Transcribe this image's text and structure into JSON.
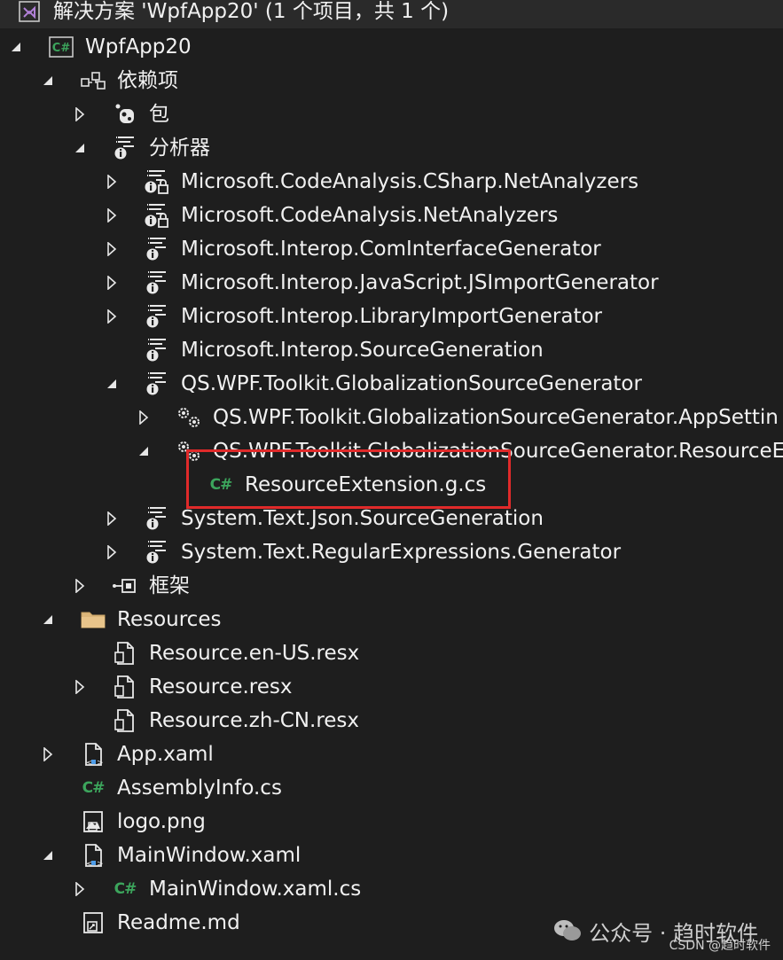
{
  "solution_title": "解决方案 'WpfApp20' (1 个项目，共 1 个)",
  "rows": [
    {
      "label": "WpfApp20",
      "icon": "csharp-project-icon",
      "indent": 0,
      "arrow": "expanded"
    },
    {
      "label": "依赖项",
      "icon": "dependencies-icon",
      "indent": 1,
      "arrow": "expanded"
    },
    {
      "label": "包",
      "icon": "package-icon",
      "indent": 2,
      "arrow": "collapsed"
    },
    {
      "label": "分析器",
      "icon": "analyzer-icon",
      "indent": 2,
      "arrow": "expanded"
    },
    {
      "label": "Microsoft.CodeAnalysis.CSharp.NetAnalyzers",
      "icon": "analyzer-lock-icon",
      "indent": 3,
      "arrow": "collapsed"
    },
    {
      "label": "Microsoft.CodeAnalysis.NetAnalyzers",
      "icon": "analyzer-lock-icon",
      "indent": 3,
      "arrow": "collapsed"
    },
    {
      "label": "Microsoft.Interop.ComInterfaceGenerator",
      "icon": "analyzer-icon",
      "indent": 3,
      "arrow": "collapsed"
    },
    {
      "label": "Microsoft.Interop.JavaScript.JSImportGenerator",
      "icon": "analyzer-icon",
      "indent": 3,
      "arrow": "collapsed"
    },
    {
      "label": "Microsoft.Interop.LibraryImportGenerator",
      "icon": "analyzer-icon",
      "indent": 3,
      "arrow": "collapsed"
    },
    {
      "label": "Microsoft.Interop.SourceGeneration",
      "icon": "analyzer-icon",
      "indent": 3,
      "arrow": "none"
    },
    {
      "label": "QS.WPF.Toolkit.GlobalizationSourceGenerator",
      "icon": "analyzer-icon",
      "indent": 3,
      "arrow": "expanded"
    },
    {
      "label": "QS.WPF.Toolkit.GlobalizationSourceGenerator.AppSettin",
      "icon": "generator-gears-icon",
      "indent": 4,
      "arrow": "collapsed"
    },
    {
      "label": "QS.WPF.Toolkit.GlobalizationSourceGenerator.ResourceE",
      "icon": "generator-gears-icon",
      "indent": 4,
      "arrow": "expanded"
    },
    {
      "label": "ResourceExtension.g.cs",
      "icon": "csharp-file-icon",
      "indent": 5,
      "arrow": "none"
    },
    {
      "label": "System.Text.Json.SourceGeneration",
      "icon": "analyzer-icon",
      "indent": 3,
      "arrow": "collapsed"
    },
    {
      "label": "System.Text.RegularExpressions.Generator",
      "icon": "analyzer-icon",
      "indent": 3,
      "arrow": "collapsed"
    },
    {
      "label": "框架",
      "icon": "framework-icon",
      "indent": 2,
      "arrow": "collapsed"
    },
    {
      "label": "Resources",
      "icon": "folder-icon",
      "indent": 1,
      "arrow": "expanded"
    },
    {
      "label": "Resource.en-US.resx",
      "icon": "resx-file-icon",
      "indent": 2,
      "arrow": "none"
    },
    {
      "label": "Resource.resx",
      "icon": "resx-file-icon",
      "indent": 2,
      "arrow": "collapsed"
    },
    {
      "label": "Resource.zh-CN.resx",
      "icon": "resx-file-icon",
      "indent": 2,
      "arrow": "none"
    },
    {
      "label": "App.xaml",
      "icon": "xaml-file-icon",
      "indent": 1,
      "arrow": "collapsed"
    },
    {
      "label": "AssemblyInfo.cs",
      "icon": "csharp-file-icon",
      "indent": 1,
      "arrow": "none"
    },
    {
      "label": "logo.png",
      "icon": "image-file-icon",
      "indent": 1,
      "arrow": "none"
    },
    {
      "label": "MainWindow.xaml",
      "icon": "xaml-file-icon",
      "indent": 1,
      "arrow": "expanded"
    },
    {
      "label": "MainWindow.xaml.cs",
      "icon": "csharp-file-icon",
      "indent": 2,
      "arrow": "collapsed"
    },
    {
      "label": "Readme.md",
      "icon": "markdown-file-icon",
      "indent": 1,
      "arrow": "none"
    }
  ],
  "watermark": {
    "text": "公众号 · 趋时软件",
    "icon": "wechat-icon"
  },
  "csdn_mark": "CSDN @趋时软件",
  "colors": {
    "background": "#1e1e1e",
    "text": "#f1f1f1",
    "highlight": "#e02a2a",
    "csharp": "#3ca55c"
  }
}
